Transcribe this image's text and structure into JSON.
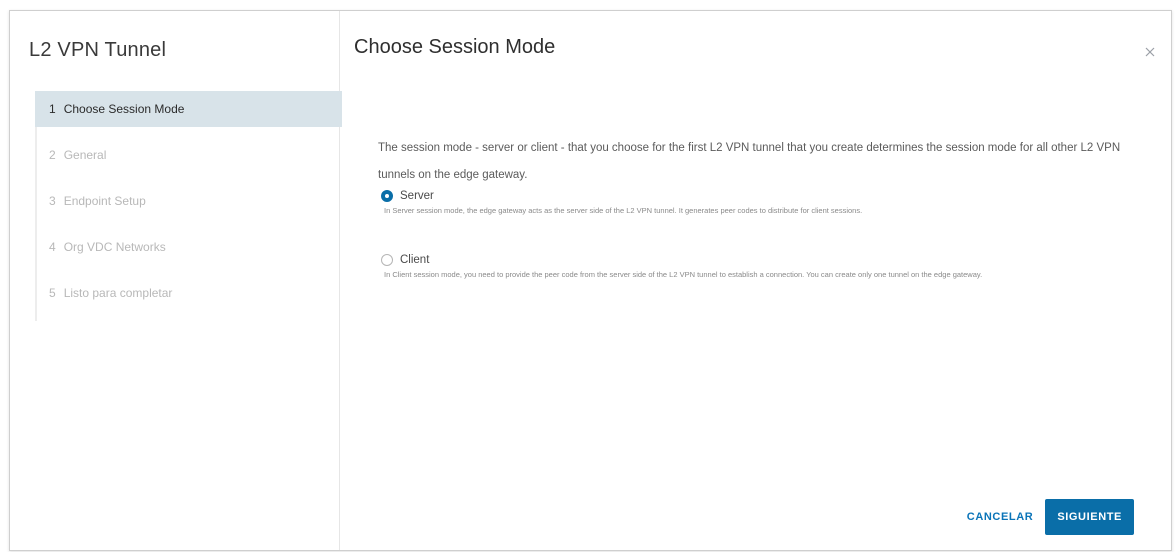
{
  "wizard": {
    "title": "L2 VPN Tunnel",
    "steps": [
      {
        "number": "1",
        "label": "Choose Session Mode",
        "active": true
      },
      {
        "number": "2",
        "label": "General",
        "active": false
      },
      {
        "number": "3",
        "label": "Endpoint Setup",
        "active": false
      },
      {
        "number": "4",
        "label": "Org VDC Networks",
        "active": false
      },
      {
        "number": "5",
        "label": "Listo para completar",
        "active": false
      }
    ]
  },
  "page": {
    "title": "Choose Session Mode",
    "description": "The session mode - server or client - that you choose for the first L2 VPN tunnel that you create determines the session mode for all other L2 VPN tunnels on the edge gateway."
  },
  "options": [
    {
      "label": "Server",
      "checked": true,
      "help": "In Server session mode, the edge gateway acts as the server side of the L2 VPN tunnel. It generates peer codes to distribute for client sessions."
    },
    {
      "label": "Client",
      "checked": false,
      "help": "In Client session mode, you need to provide the peer code from the server side of the L2 VPN tunnel to establish a connection. You can create only one tunnel on the edge gateway."
    }
  ],
  "actions": {
    "cancel_label": "CANCELAR",
    "next_label": "SIGUIENTE"
  },
  "icons": {
    "close": "close-icon"
  },
  "colors": {
    "accent": "#0a6ea8",
    "active_step_bg": "#d8e3e9"
  }
}
